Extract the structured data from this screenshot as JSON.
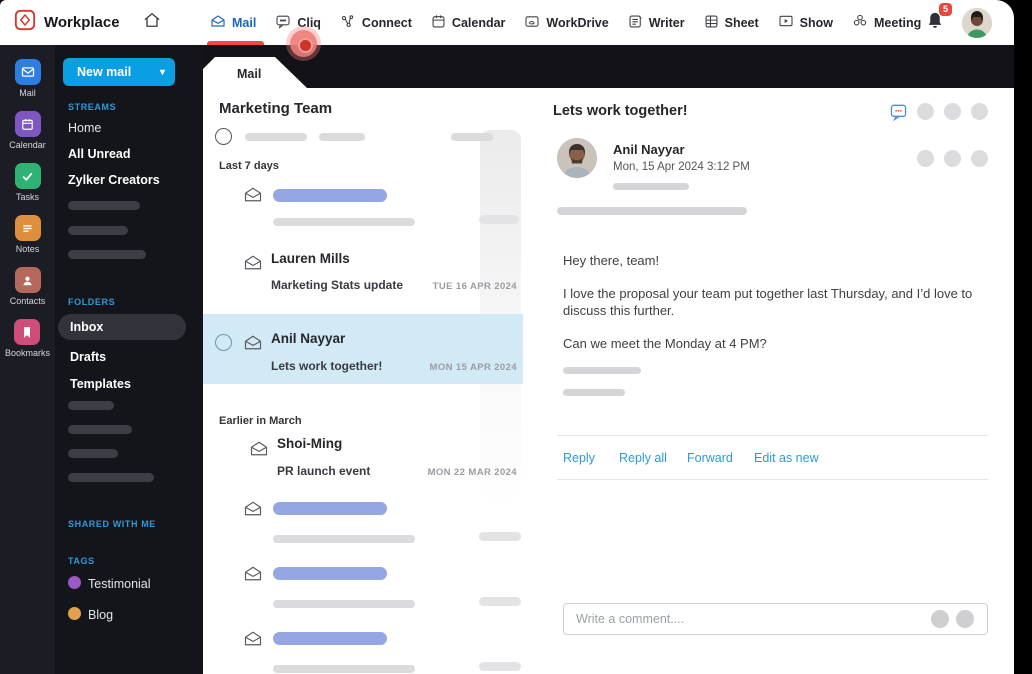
{
  "topnav": {
    "brand": "Workplace",
    "notification_count": "5",
    "tabs": [
      {
        "label": "Mail",
        "icon": "mail-icon",
        "active": true
      },
      {
        "label": "Cliq",
        "icon": "chat-icon"
      },
      {
        "label": "Connect",
        "icon": "network-icon"
      },
      {
        "label": "Calendar",
        "icon": "calendar-icon"
      },
      {
        "label": "WorkDrive",
        "icon": "drive-icon"
      },
      {
        "label": "Writer",
        "icon": "writer-icon"
      },
      {
        "label": "Sheet",
        "icon": "sheet-icon"
      },
      {
        "label": "Show",
        "icon": "show-icon"
      },
      {
        "label": "Meeting",
        "icon": "meeting-icon"
      }
    ]
  },
  "app_rail": {
    "items": [
      {
        "label": "Mail",
        "icon": "mail-icon",
        "color": "#2e7de0"
      },
      {
        "label": "Calendar",
        "icon": "calendar-icon",
        "color": "#7e57c2"
      },
      {
        "label": "Tasks",
        "icon": "check-icon",
        "color": "#2fb374"
      },
      {
        "label": "Notes",
        "icon": "notes-icon",
        "color": "#dd8f3d"
      },
      {
        "label": "Contacts",
        "icon": "person-icon",
        "color": "#b5685c"
      },
      {
        "label": "Bookmarks",
        "icon": "bookmark-icon",
        "color": "#cf4d79"
      }
    ]
  },
  "folder_sidebar": {
    "new_mail_label": "New mail",
    "streams": {
      "label": "STREAMS",
      "items": [
        "Home",
        "All Unread",
        "Zylker Creators"
      ]
    },
    "folders": {
      "label": "FOLDERS",
      "items": [
        "Inbox",
        "Drafts",
        "Templates"
      ],
      "selected": "Inbox"
    },
    "shared": {
      "label": "SHARED WITH ME"
    },
    "tags": {
      "label": "TAGS",
      "items": [
        {
          "name": "Testimonial",
          "color": "#9b59c8"
        },
        {
          "name": "Blog",
          "color": "#e2a14e"
        }
      ]
    }
  },
  "mail_panel": {
    "tab_label": "Mail",
    "list_title": "Marketing Team",
    "groups": [
      {
        "label": "Last 7 days"
      },
      {
        "label": "Earlier in March"
      }
    ],
    "messages": [
      {
        "sender": "Lauren Mills",
        "subject": "Marketing Stats update",
        "date": "TUE 16 APR 2024",
        "selected": false
      },
      {
        "sender": "Anil Nayyar",
        "subject": "Lets work together!",
        "date": "MON 15 APR 2024",
        "selected": true
      },
      {
        "sender": "Shoi-Ming",
        "subject": "PR launch event",
        "date": "MON 22 MAR 2024",
        "selected": false
      }
    ]
  },
  "reading_pane": {
    "subject": "Lets work together!",
    "sender_name": "Anil Nayyar",
    "sent_datetime": "Mon, 15 Apr 2024 3:12 PM",
    "body_paragraphs": [
      "Hey there, team!",
      "I love the proposal your team put together last Thursday, and I’d love to discuss this further.",
      "Can we meet the Monday at 4 PM?"
    ],
    "actions": [
      "Reply",
      "Reply all",
      "Forward",
      "Edit as new"
    ],
    "comment_placeholder": "Write a comment...."
  },
  "colors": {
    "accent_blue": "#0a9ee2",
    "active_tab_blue": "#1766c1",
    "active_underline_red": "#ee4c43",
    "selected_mail_bg": "#d2eaf6",
    "link_blue": "#2b9cd8",
    "placeholder_blue": "#94a6e4"
  }
}
